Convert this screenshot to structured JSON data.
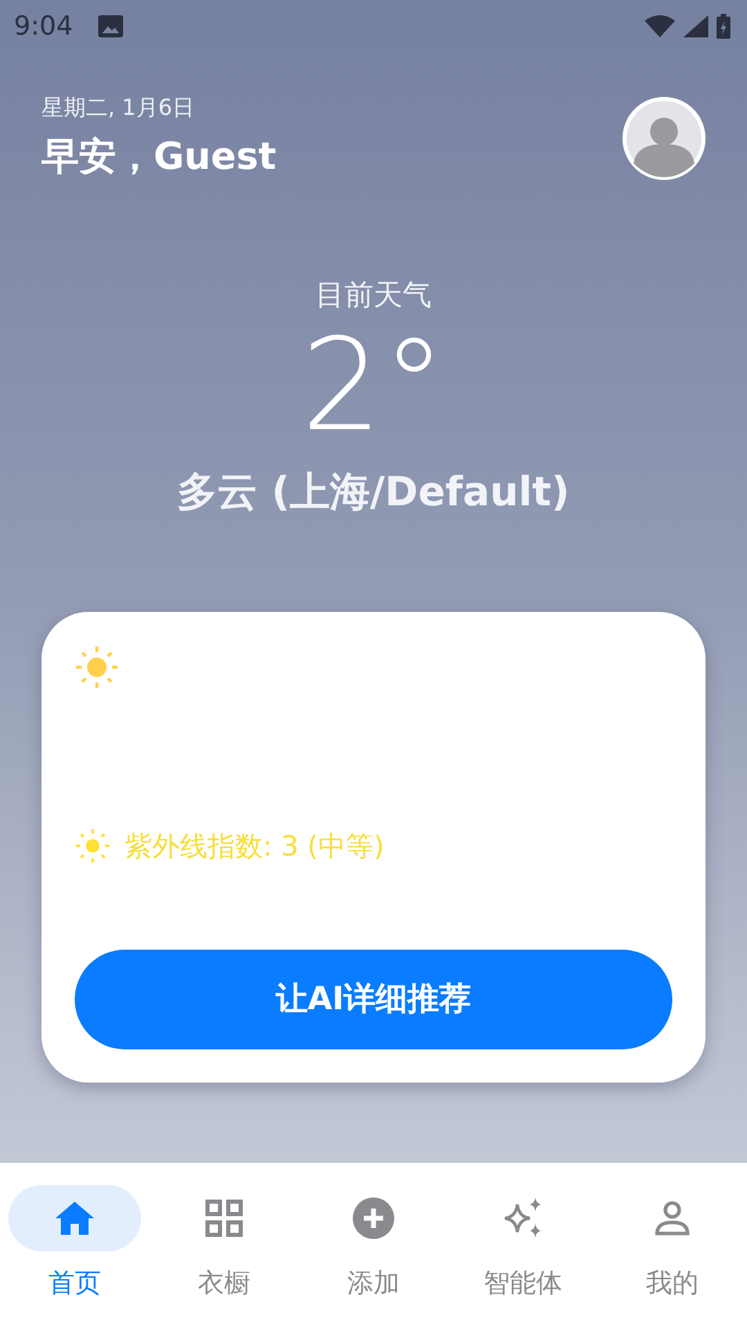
{
  "status_bar": {
    "time": "9:04"
  },
  "header": {
    "date": "星期二, 1月6日",
    "greeting": "早安，Guest"
  },
  "weather": {
    "label": "目前天气",
    "temperature": "2°",
    "condition": "多云 (上海/Default)"
  },
  "card": {
    "uv": "紫外线指数: 3 (中等)",
    "button": "让AI详细推荐"
  },
  "tabs": [
    {
      "label": "首页",
      "kind": "home",
      "selected": true
    },
    {
      "label": "衣橱",
      "kind": "grid",
      "selected": false
    },
    {
      "label": "添加",
      "kind": "add",
      "selected": false
    },
    {
      "label": "智能体",
      "kind": "sparkle",
      "selected": false
    },
    {
      "label": "我的",
      "kind": "person",
      "selected": false
    }
  ]
}
